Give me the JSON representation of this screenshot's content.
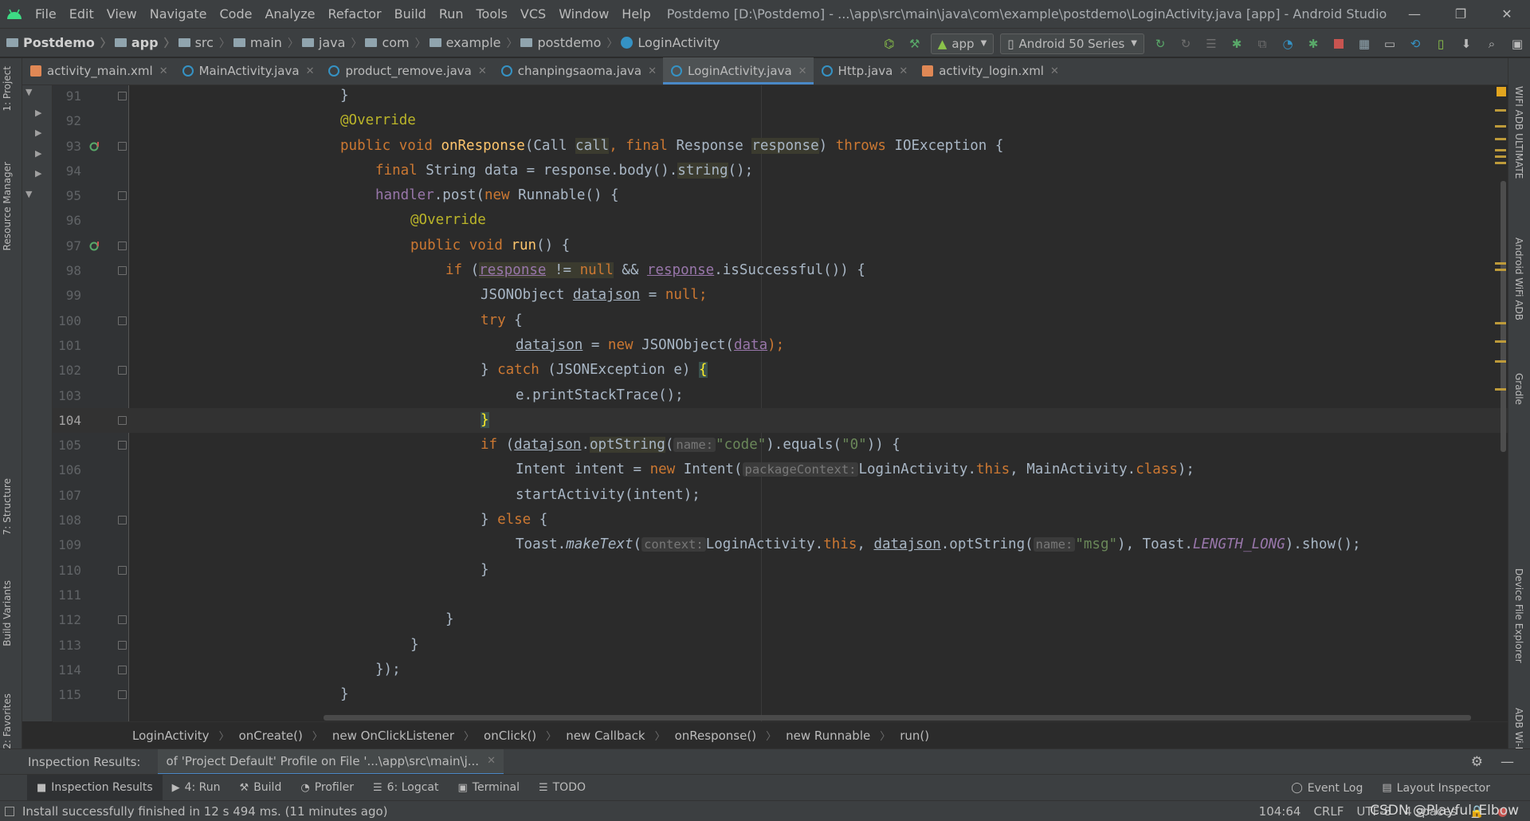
{
  "menubar": {
    "items": [
      "File",
      "Edit",
      "View",
      "Navigate",
      "Code",
      "Analyze",
      "Refactor",
      "Build",
      "Run",
      "Tools",
      "VCS",
      "Window",
      "Help"
    ],
    "window_title": "Postdemo [D:\\Postdemo] - ...\\app\\src\\main\\java\\com\\example\\postdemo\\LoginActivity.java [app] - Android Studio"
  },
  "navbar": {
    "breadcrumb": [
      "Postdemo",
      "app",
      "src",
      "main",
      "java",
      "com",
      "example",
      "postdemo",
      "LoginActivity"
    ],
    "run_config": "app",
    "device": "Android 50 Series"
  },
  "tabs": [
    {
      "label": "activity_main.xml",
      "type": "xml"
    },
    {
      "label": "MainActivity.java",
      "type": "java"
    },
    {
      "label": "product_remove.java",
      "type": "java"
    },
    {
      "label": "chanpingsaoma.java",
      "type": "java"
    },
    {
      "label": "LoginActivity.java",
      "type": "java",
      "active": true
    },
    {
      "label": "Http.java",
      "type": "java"
    },
    {
      "label": "activity_login.xml",
      "type": "xml"
    }
  ],
  "left_strip": {
    "project": "1: Project",
    "resource_manager": "Resource Manager",
    "structure": "7: Structure",
    "build_variants": "Build Variants",
    "favorites": "2: Favorites"
  },
  "right_strip": {
    "wifi_adb_ultimate": "WIFI ADB ULTIMATE",
    "android_wifi_adb": "Android WiFi ADB",
    "gradle": "Gradle",
    "device_file_explorer": "Device File Explorer",
    "adb_wifi": "ADB Wi-Fi"
  },
  "editor": {
    "current_line": 104,
    "line_numbers": [
      "91",
      "92",
      "93",
      "94",
      "95",
      "96",
      "97",
      "98",
      "99",
      "100",
      "101",
      "102",
      "103",
      "104",
      "105",
      "106",
      "107",
      "108",
      "109",
      "110",
      "111",
      "112",
      "113",
      "114",
      "115"
    ],
    "code": {
      "l91": "}",
      "l92": "@Override",
      "l93": [
        "public ",
        "void ",
        "onResponse",
        "(Call ",
        "call",
        ", ",
        "final ",
        "Response ",
        "response",
        ") ",
        "throws ",
        "IOException {"
      ],
      "l94": [
        "final ",
        "String data = response.body().",
        "string",
        "();"
      ],
      "l95": [
        "handler",
        ".post(",
        "new ",
        "Runnable() {"
      ],
      "l96": "@Override",
      "l97": [
        "public ",
        "void ",
        "run",
        "() {"
      ],
      "l98": [
        "if ",
        "(",
        "response",
        " != ",
        "null",
        " && ",
        "response",
        ".isSuccessful()) {"
      ],
      "l99": [
        "JSONObject ",
        "datajson",
        " = ",
        "null",
        ";"
      ],
      "l100": [
        "try ",
        "{"
      ],
      "l101": [
        "datajson",
        " = ",
        "new ",
        "JSONObject(",
        "data",
        ");"
      ],
      "l102": [
        "} ",
        "catch ",
        "(JSONException e) ",
        "{"
      ],
      "l103": "e.printStackTrace();",
      "l104": "}",
      "l105": [
        "if ",
        "(",
        "datajson",
        ".",
        "optString",
        "(",
        "name:",
        "\"code\"",
        ").equals(",
        "\"0\"",
        ")) {"
      ],
      "l106": [
        "Intent intent = ",
        "new ",
        "Intent(",
        "packageContext:",
        "LoginActivity.",
        "this",
        ", MainActivity.",
        "class",
        ");"
      ],
      "l107": "startActivity(intent);",
      "l108": [
        "} ",
        "else ",
        "{"
      ],
      "l109": [
        "Toast.",
        "makeText",
        "(",
        "context:",
        "LoginActivity.",
        "this",
        ", ",
        "datajson",
        ".optString(",
        "name:",
        "\"msg\"",
        "), Toast.",
        "LENGTH_LONG",
        ").show();"
      ],
      "l110": "}",
      "l112": "}",
      "l113": "}",
      "l114": "});",
      "l115": "}"
    }
  },
  "code_breadcrumb": [
    "LoginActivity",
    "onCreate()",
    "new OnClickListener",
    "onClick()",
    "new Callback",
    "onResponse()",
    "new Runnable",
    "run()"
  ],
  "inspection": {
    "title": "Inspection Results:",
    "tab_label": "of 'Project Default' Profile on File '...\\app\\src\\main\\j..."
  },
  "tool_windows": {
    "left": [
      {
        "label": "Inspection Results",
        "glyph": "■",
        "active": true
      },
      {
        "label": "4: Run",
        "glyph": "▶"
      },
      {
        "label": "Build",
        "glyph": "🔨"
      },
      {
        "label": "Profiler",
        "glyph": "◔"
      },
      {
        "label": "6: Logcat",
        "glyph": "☰"
      },
      {
        "label": "Terminal",
        "glyph": "▣"
      },
      {
        "label": "TODO",
        "glyph": "☰"
      }
    ],
    "right": [
      {
        "label": "Event Log",
        "glyph": "◯"
      },
      {
        "label": "Layout Inspector",
        "glyph": "▤"
      }
    ]
  },
  "status": {
    "message": "Install successfully finished in 12 s 494 ms. (11 minutes ago)",
    "position": "104:64",
    "line_sep": "CRLF",
    "encoding": "UTF-8",
    "indent": "4 spaces",
    "watermark": "CSDN @Playful_Elbow"
  },
  "colors": {
    "bg": "#2b2b2b",
    "chrome": "#3c3f41",
    "keyword": "#cc7832",
    "annotation": "#bbb529",
    "string": "#6a8759",
    "field": "#9876aa",
    "method": "#ffc66d",
    "accent": "#4a88c7"
  }
}
